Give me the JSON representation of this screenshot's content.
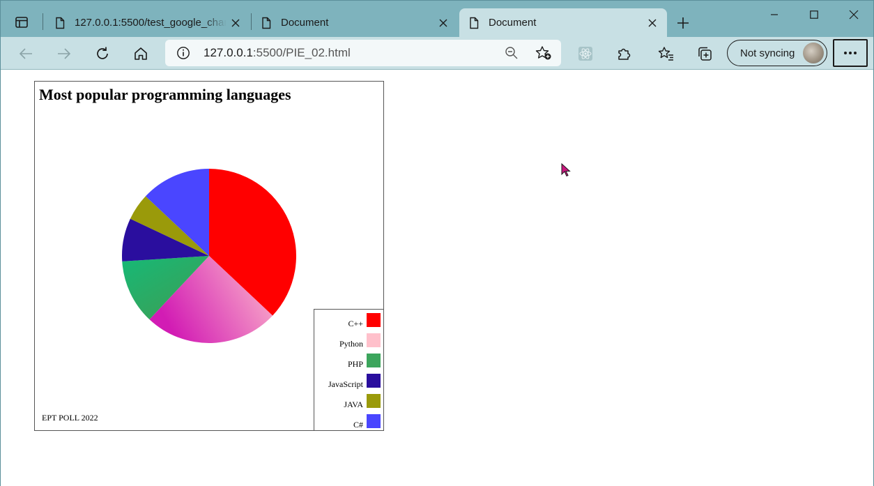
{
  "browser": {
    "tabs": [
      {
        "title": "127.0.0.1:5500/test_google_charts.html",
        "active": false
      },
      {
        "title": "Document",
        "active": false
      },
      {
        "title": "Document",
        "active": true
      }
    ],
    "address": {
      "host": "127.0.0.1",
      "rest": ":5500/PIE_02.html"
    },
    "sync_label": "Not syncing",
    "accent": "#7eb3bd",
    "toolbar_bg": "#c8e0e4"
  },
  "chart_data": {
    "type": "pie",
    "title": "Most popular programming languages",
    "source": "EPT POLL 2022",
    "legend_position": "bottom-right",
    "slices": [
      {
        "label": "C++",
        "value": 37,
        "color": "#ff0000"
      },
      {
        "label": "Python",
        "value": 25,
        "color": "#ffc0cb"
      },
      {
        "label": "PHP",
        "value": 12,
        "color": "#3ca55c"
      },
      {
        "label": "JavaScript",
        "value": 8,
        "color": "#2a0e9e"
      },
      {
        "label": "JAVA",
        "value": 5,
        "color": "#9a9a0a"
      },
      {
        "label": "C#",
        "value": 13,
        "color": "#4a46ff"
      }
    ]
  }
}
